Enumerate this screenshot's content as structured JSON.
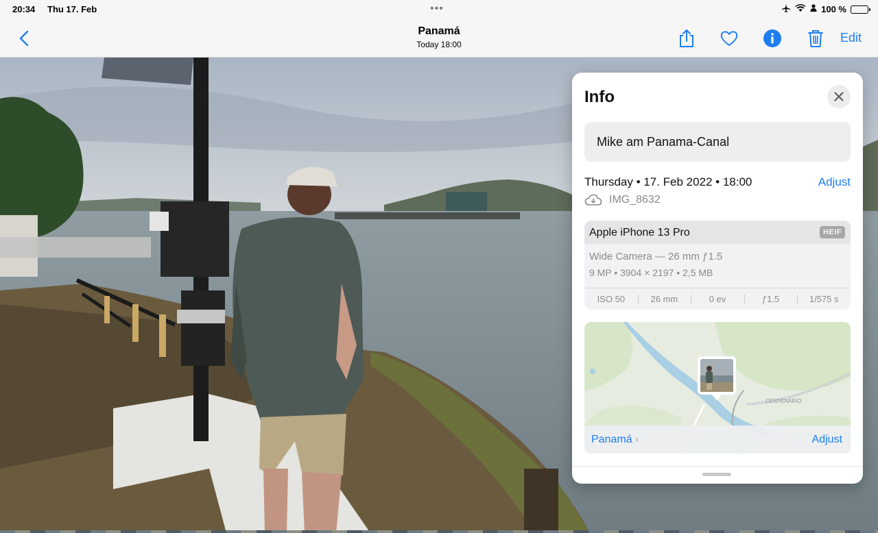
{
  "status_bar": {
    "time": "20:34",
    "date": "Thu 17. Feb",
    "battery_text": "100 %",
    "multitask_dots": "•••"
  },
  "nav": {
    "title": "Panamá",
    "subtitle": "Today  18:00",
    "edit_label": "Edit",
    "icons": [
      "back-chevron-icon",
      "share-icon",
      "heart-icon",
      "info-icon",
      "trash-icon"
    ],
    "accent_color": "#1e7ef0"
  },
  "info_panel": {
    "title": "Info",
    "caption": "Mike am Panama-Canal",
    "date_line": "Thursday • 17. Feb 2022 • 18:00",
    "adjust_label": "Adjust",
    "filename": "IMG_8632",
    "camera": {
      "model": "Apple iPhone 13 Pro",
      "format_badge": "HEIF",
      "lens": "Wide Camera — 26 mm ƒ1.5",
      "specs": "9 MP  •  3904 × 2197  •  2,5 MB",
      "exif": [
        "ISO 50",
        "26 mm",
        "0 ev",
        "ƒ1.5",
        "1/575 s"
      ]
    },
    "map": {
      "place": "Panamá",
      "road_label": "CENTENARIO",
      "adjust_label": "Adjust"
    }
  }
}
